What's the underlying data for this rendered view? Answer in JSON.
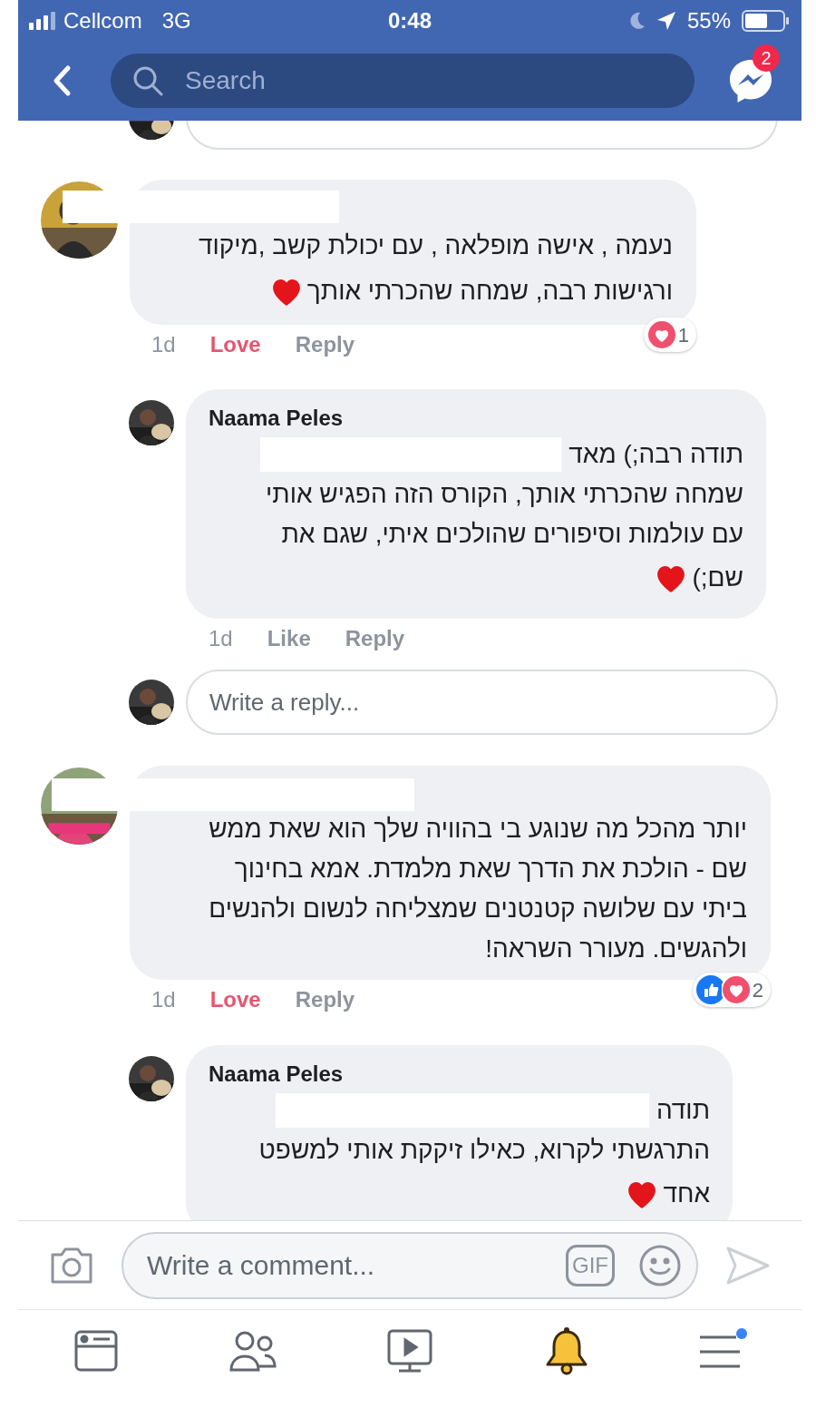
{
  "status_bar": {
    "carrier": "Cellcom",
    "network": "3G",
    "time": "0:48",
    "battery": "55%"
  },
  "nav": {
    "search_placeholder": "Search",
    "messages_badge": "2"
  },
  "thread": [
    {
      "kind": "comment",
      "name_redacted": true,
      "lines": [
        {
          "text": "נעמה , אישה מופלאה , עם יכולת קשב ,מיקוד"
        },
        {
          "text": "ורגישות רבה, שמחה שהכרתי אותך",
          "heart": true
        }
      ],
      "time": "1d",
      "react_label": "Love",
      "reacted": true,
      "reply_label": "Reply",
      "reactions": {
        "items": [
          {
            "kind": "love"
          }
        ],
        "count": "1"
      }
    },
    {
      "kind": "reply",
      "author": "Naama Peles",
      "lines": [
        {
          "text": "תודה רבה;) מאד",
          "redacted": true
        },
        {
          "text": "שמחה שהכרתי אותך, הקורס הזה הפגיש אותי"
        },
        {
          "text": "עם עולמות וסיפורים שהולכים איתי, שגם את"
        },
        {
          "text": "שם;)",
          "heart": true
        }
      ],
      "time": "1d",
      "react_label": "Like",
      "reacted": false,
      "reply_label": "Reply"
    },
    {
      "kind": "reply_field",
      "placeholder": "Write a reply..."
    },
    {
      "kind": "comment",
      "name_redacted": true,
      "lines": [
        {
          "text": "יותר מהכל מה שנוגע בי בהוויה שלך הוא שאת ממש"
        },
        {
          "text": "שם - הולכת את הדרך שאת מלמדת. אמא בחינוך"
        },
        {
          "text": "ביתי עם שלושה קטנטנים שמצליחה לנשום ולהנשים"
        },
        {
          "text": "ולהגשים. מעורר השראה!"
        }
      ],
      "time": "1d",
      "react_label": "Love",
      "reacted": true,
      "reply_label": "Reply",
      "reactions": {
        "items": [
          {
            "kind": "like"
          },
          {
            "kind": "love"
          }
        ],
        "count": "2"
      }
    },
    {
      "kind": "reply",
      "author": "Naama Peles",
      "lines": [
        {
          "text": "תודה",
          "redacted": true
        },
        {
          "text": "התרגשתי לקרוא, כאילו זיקקת אותי למשפט"
        },
        {
          "text": "אחד",
          "heart": true
        }
      ]
    }
  ],
  "composer": {
    "placeholder": "Write a comment...",
    "gif": "GIF"
  },
  "tabs": [
    {
      "kind": "feed",
      "selected": false
    },
    {
      "kind": "friends",
      "selected": false
    },
    {
      "kind": "video",
      "selected": false
    },
    {
      "kind": "notifications",
      "selected": true
    },
    {
      "kind": "menu",
      "selected": false,
      "dot": true
    }
  ]
}
